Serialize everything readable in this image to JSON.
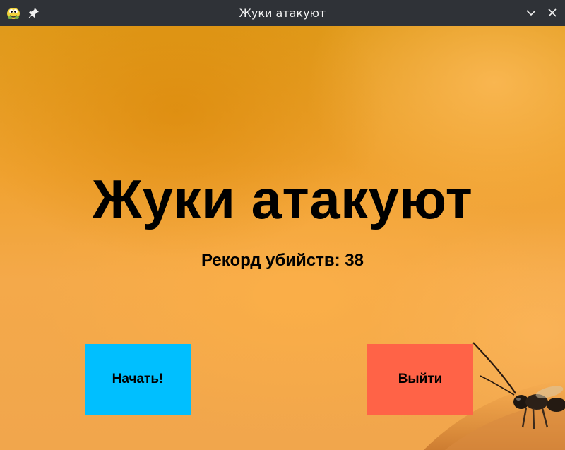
{
  "window": {
    "title": "Жуки атакуют",
    "icons": [
      "pygame-snake-icon",
      "pin-icon",
      "minimize-chevron-icon",
      "close-icon"
    ]
  },
  "game": {
    "title": "Жуки атакуют",
    "record_label": "Рекорд убийств: 38",
    "record_value": 38,
    "buttons": {
      "start": "Начать!",
      "exit": "Выйти"
    }
  },
  "colors": {
    "titlebar_bg": "#2f3237",
    "start_button": "#00bfff",
    "exit_button": "#ff6347",
    "background_orange": "#f0a230",
    "text": "#000000"
  }
}
